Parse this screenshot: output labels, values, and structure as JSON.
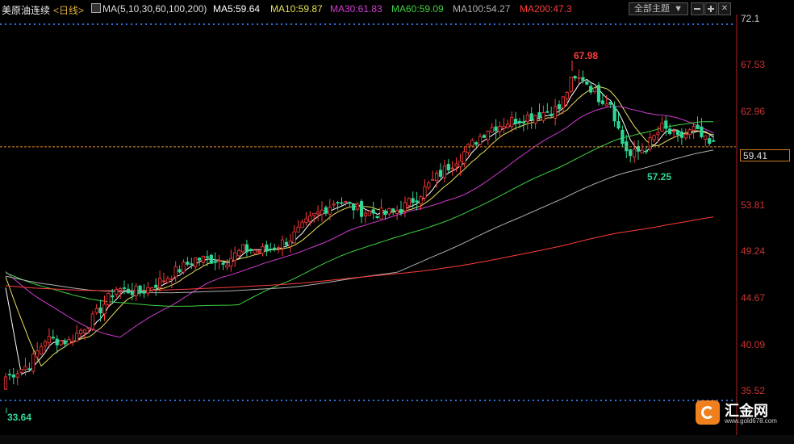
{
  "header": {
    "instrument": "美原油连续",
    "period": "<日线>",
    "ma_params": "MA(5,10,30,60,100,200)",
    "theme_select": "全部主题",
    "theme_arrow": "▼",
    "ma": [
      {
        "label": "MA5:59.64",
        "color": "#ffffff"
      },
      {
        "label": "MA10:59.87",
        "color": "#e8e05a"
      },
      {
        "label": "MA30:61.83",
        "color": "#d23cd2"
      },
      {
        "label": "MA60:59.09",
        "color": "#3fd23f"
      },
      {
        "label": "MA100:54.27",
        "color": "#b0b0b0"
      },
      {
        "label": "MA200:47.3",
        "color": "#ff3b3b"
      }
    ]
  },
  "current_price_label": "59.41",
  "logo": {
    "name": "汇金网",
    "site": "www.gold678.com"
  },
  "colors": {
    "up": "#ff3b3b",
    "down": "#2fd896",
    "grid_dots": "#2f6fd8",
    "price_line": "#e08a2a"
  },
  "chart_data": {
    "type": "candlestick",
    "y_ticks": [
      72.1,
      67.53,
      62.96,
      59.41,
      53.81,
      49.24,
      44.67,
      40.09,
      35.52
    ],
    "ylim": [
      35.52,
      72.1
    ],
    "current_price": 59.41,
    "annotations": [
      {
        "label": "67.98",
        "index": 0,
        "value": 67.98,
        "kind": "high"
      },
      {
        "label": "57.25",
        "index": 0,
        "value": 57.25,
        "kind": "low"
      },
      {
        "label": "33.64",
        "index": 0,
        "value": 33.64,
        "kind": "low"
      }
    ],
    "keypoints": [
      [
        0,
        36.8
      ],
      [
        6,
        38.0
      ],
      [
        10,
        40.5
      ],
      [
        16,
        40.3
      ],
      [
        22,
        42.5
      ],
      [
        28,
        45.5
      ],
      [
        34,
        45.1
      ],
      [
        40,
        46.4
      ],
      [
        48,
        48.4
      ],
      [
        56,
        48.3
      ],
      [
        60,
        49.3
      ],
      [
        66,
        49.2
      ],
      [
        72,
        50.4
      ],
      [
        78,
        52.6
      ],
      [
        84,
        54.2
      ],
      [
        90,
        53.1
      ],
      [
        96,
        52.8
      ],
      [
        100,
        53.3
      ],
      [
        104,
        54.5
      ],
      [
        110,
        56.8
      ],
      [
        116,
        58.9
      ],
      [
        122,
        61.2
      ],
      [
        128,
        62.0
      ],
      [
        134,
        62.6
      ],
      [
        140,
        63.2
      ],
      [
        143,
        65.8
      ],
      [
        146,
        66.2
      ],
      [
        150,
        64.3
      ],
      [
        153,
        63.8
      ],
      [
        156,
        59.8
      ],
      [
        158,
        58.5
      ],
      [
        162,
        59.4
      ],
      [
        166,
        61.3
      ],
      [
        170,
        60.2
      ],
      [
        174,
        61.1
      ],
      [
        178,
        59.6
      ]
    ],
    "candle_count": 180
  }
}
